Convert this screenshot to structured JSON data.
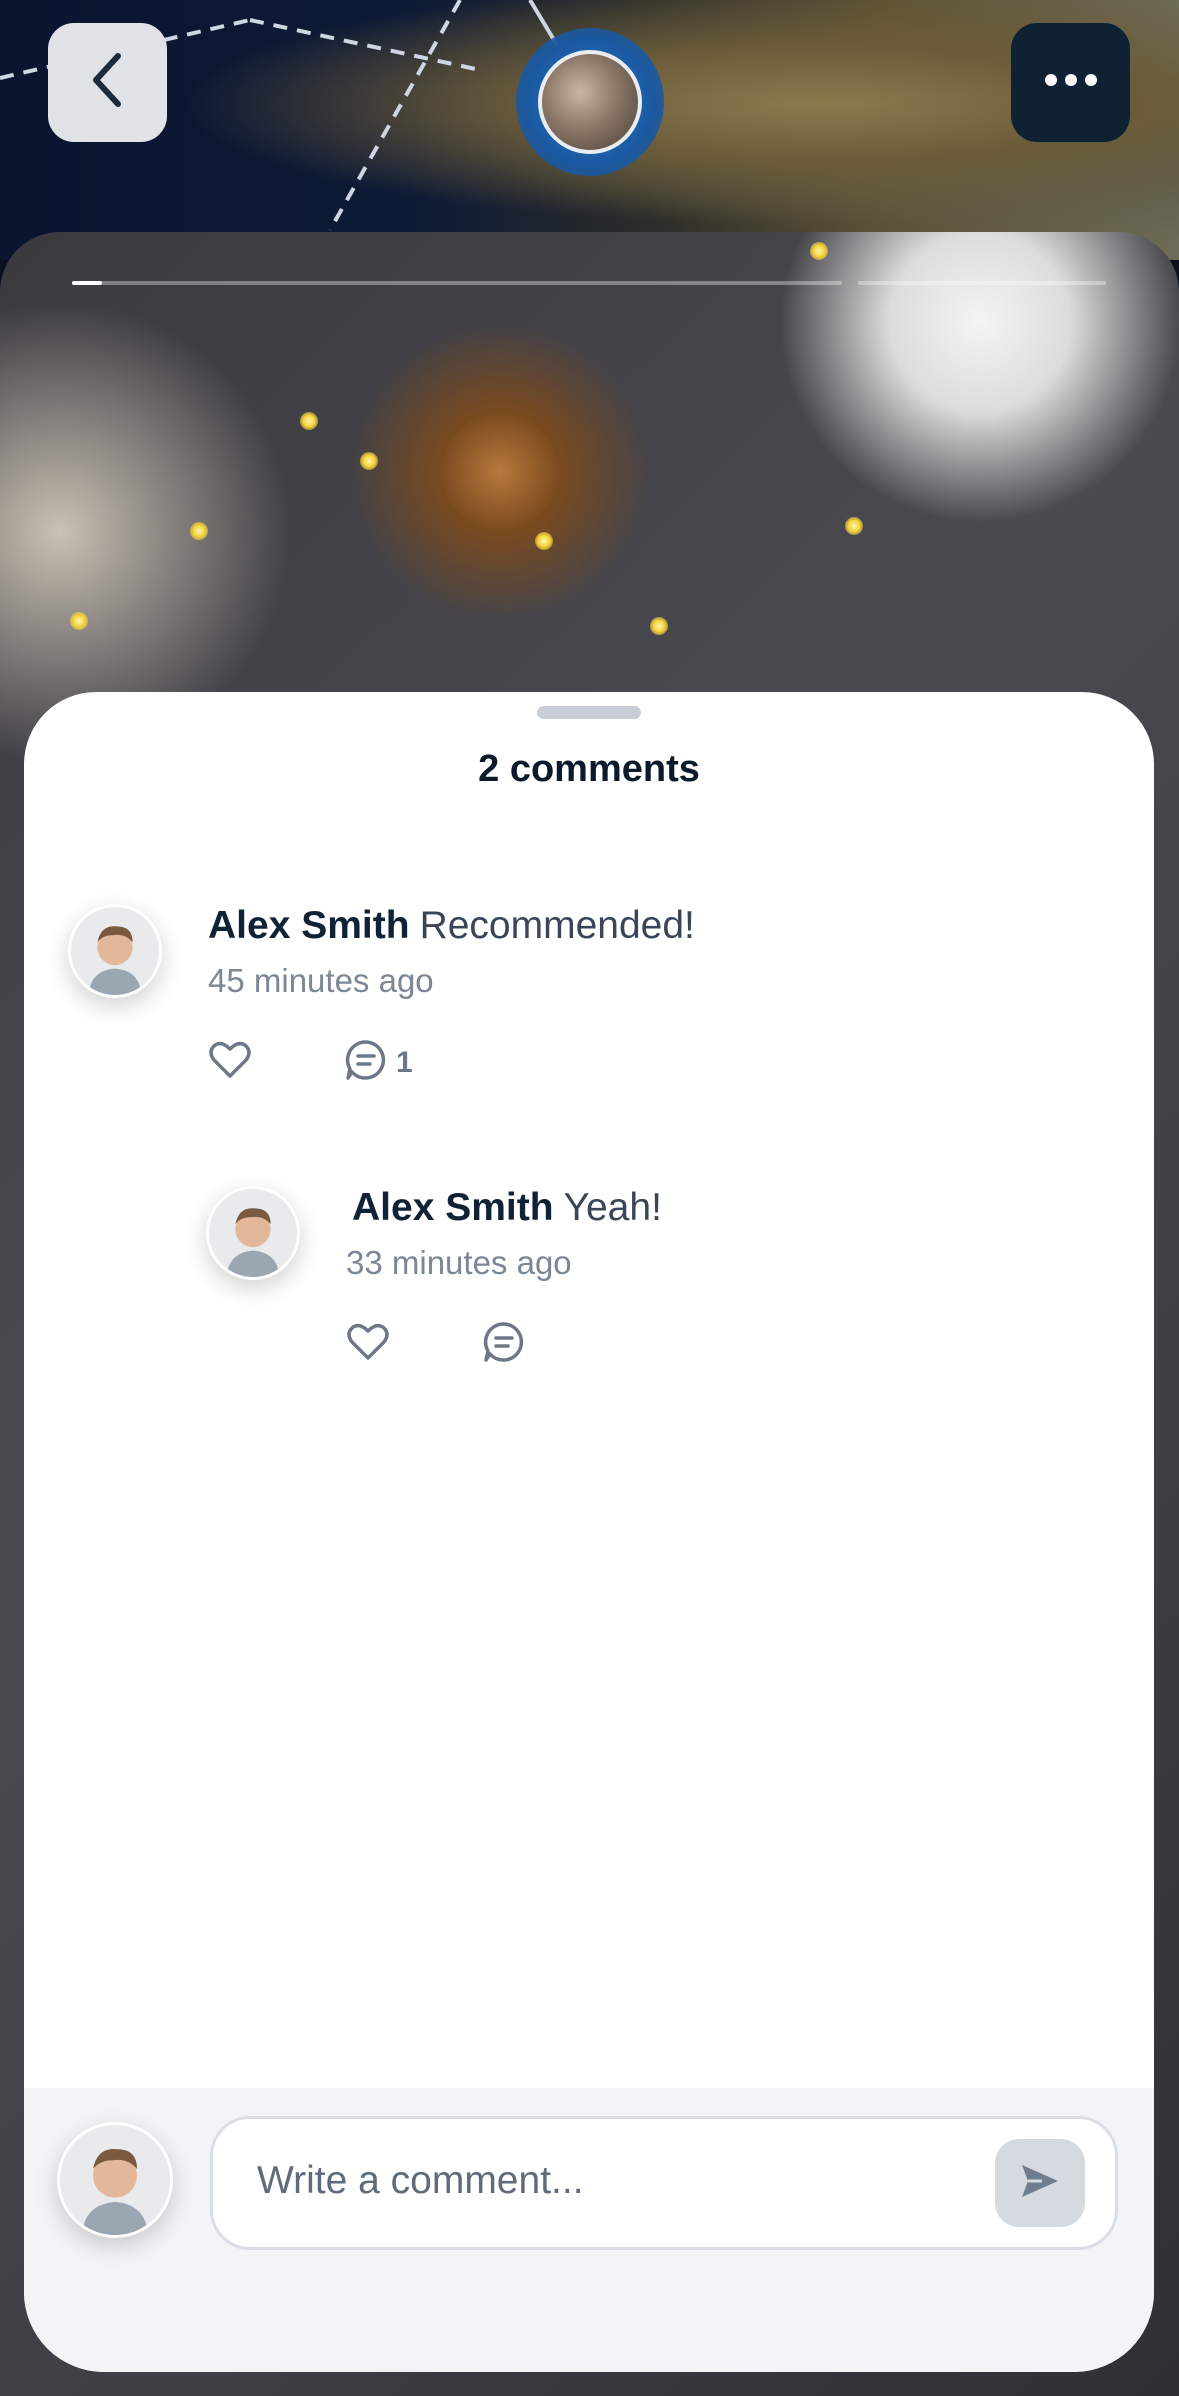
{
  "header": {
    "back_icon": "chevron-left-icon",
    "more_icon": "more-horizontal-icon",
    "map_pin_icon": "location-photo-pin"
  },
  "sheet": {
    "title": "2 comments"
  },
  "comments": [
    {
      "author": "Alex Smith",
      "text": "Recommended!",
      "time": "45 minutes ago",
      "reply_count": "1"
    },
    {
      "author": "Alex Smith",
      "text": "Yeah!",
      "time": "33 minutes ago"
    }
  ],
  "composer": {
    "placeholder": "Write a comment...",
    "send_icon": "send-icon"
  },
  "colors": {
    "back_button_bg": "#dfe3e8",
    "more_button_bg": "#0e2233",
    "text_primary": "#0f2236",
    "text_secondary": "#7c8796",
    "composer_bg": "#f2f4f6"
  }
}
